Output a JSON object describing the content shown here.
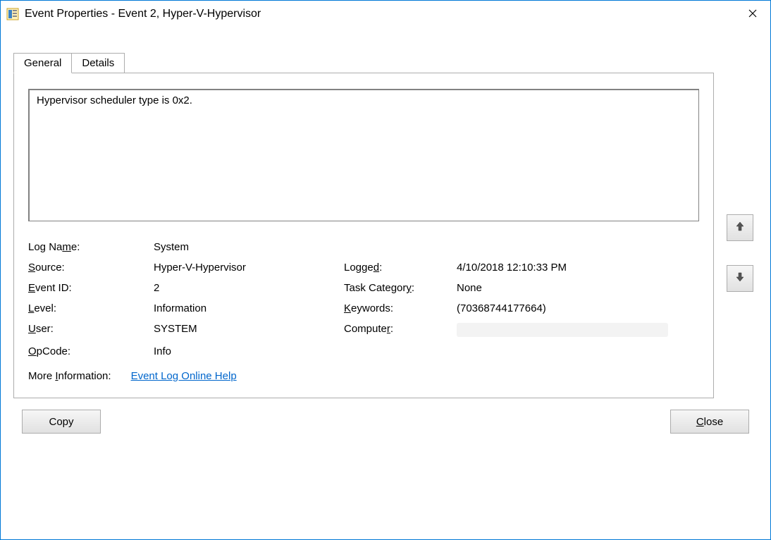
{
  "window": {
    "title": "Event Properties - Event 2, Hyper-V-Hypervisor"
  },
  "tabs": {
    "general": "General",
    "details": "Details"
  },
  "description": "Hypervisor scheduler type is 0x2.",
  "fields": {
    "log_name": {
      "label_pre": "Log Na",
      "label_ul": "m",
      "label_post": "e:",
      "value": "System"
    },
    "source": {
      "label_ul": "S",
      "label_post": "ource:",
      "value": "Hyper-V-Hypervisor"
    },
    "logged": {
      "label_pre": "Logge",
      "label_ul": "d",
      "label_post": ":",
      "value": "4/10/2018 12:10:33 PM"
    },
    "event_id": {
      "label_ul": "E",
      "label_post": "vent ID:",
      "value": "2"
    },
    "task_category": {
      "label_pre": "Task Categor",
      "label_ul": "y",
      "label_post": ":",
      "value": "None"
    },
    "level": {
      "label_ul": "L",
      "label_post": "evel:",
      "value": "Information"
    },
    "keywords": {
      "label_ul": "K",
      "label_post": "eywords:",
      "value": "(70368744177664)"
    },
    "user": {
      "label_ul": "U",
      "label_post": "ser:",
      "value": "SYSTEM"
    },
    "computer": {
      "label_pre": "Compute",
      "label_ul": "r",
      "label_post": ":",
      "value": ""
    },
    "opcode": {
      "label_ul": "O",
      "label_post": "pCode:",
      "value": "Info"
    },
    "more_info": {
      "label_pre": "More ",
      "label_ul": "I",
      "label_post": "nformation:",
      "link": "Event Log Online Help"
    }
  },
  "buttons": {
    "copy": "Copy",
    "close_pre": "",
    "close_ul": "C",
    "close_post": "lose"
  }
}
